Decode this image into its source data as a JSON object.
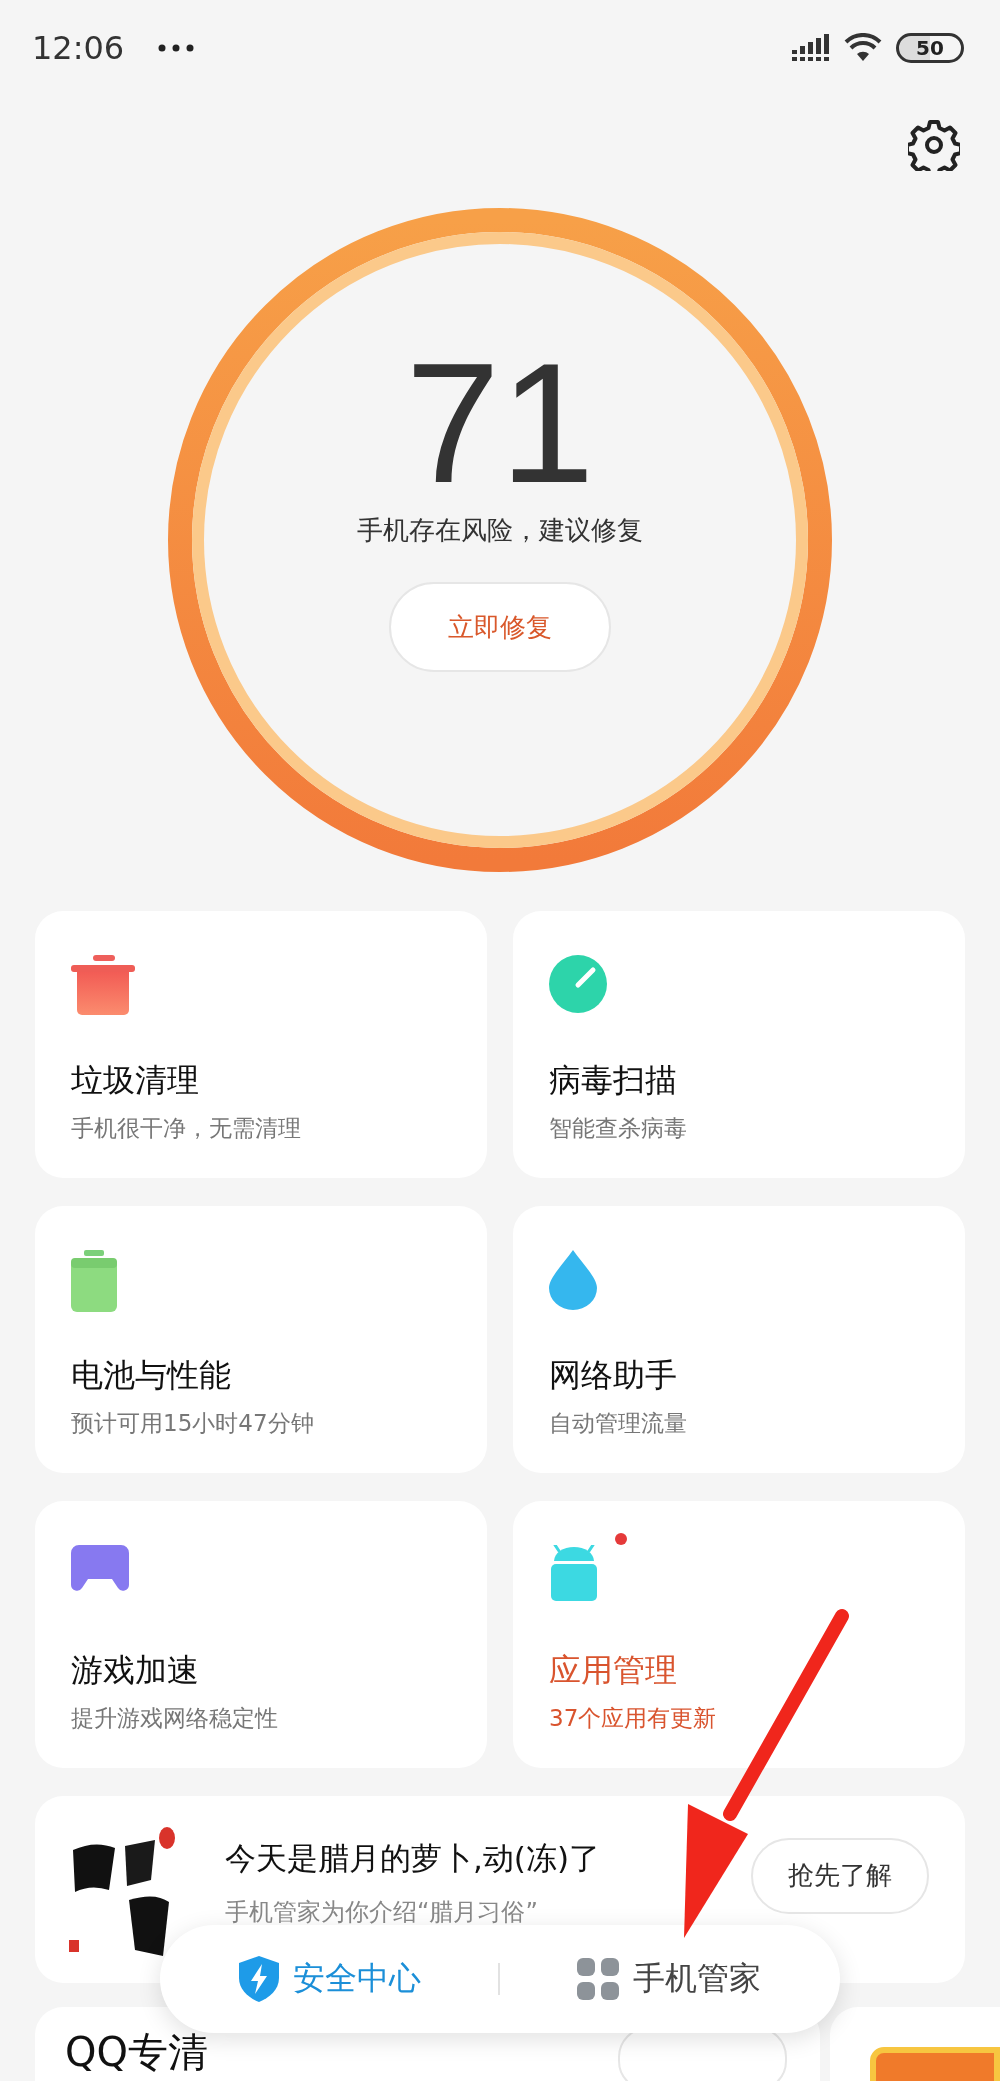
{
  "status_bar": {
    "time": "12:06",
    "battery": "50"
  },
  "score": {
    "value": "71",
    "message": "手机存在风险，建议修复",
    "action": "立即修复"
  },
  "tiles": [
    {
      "kind": "trash",
      "title": "垃圾清理",
      "subtitle": "手机很干净，无需清理",
      "highlight": false,
      "badge": false
    },
    {
      "kind": "gauge",
      "title": "病毒扫描",
      "subtitle": "智能查杀病毒",
      "highlight": false,
      "badge": false
    },
    {
      "kind": "battery",
      "title": "电池与性能",
      "subtitle": "预计可用15小时47分钟",
      "highlight": false,
      "badge": false
    },
    {
      "kind": "drop",
      "title": "网络助手",
      "subtitle": "自动管理流量",
      "highlight": false,
      "badge": false
    },
    {
      "kind": "gamepad",
      "title": "游戏加速",
      "subtitle": "提升游戏网络稳定性",
      "highlight": false,
      "badge": false
    },
    {
      "kind": "android",
      "title": "应用管理",
      "subtitle": "37个应用有更新",
      "highlight": true,
      "badge": true
    }
  ],
  "banner": {
    "title": "今天是腊月的萝卜,动(冻)了",
    "subtitle": "手机管家为你介绍“腊月习俗”",
    "action": "抢先了解"
  },
  "next_card": {
    "title": "QQ专清"
  },
  "bottom_nav": [
    {
      "kind": "shield",
      "label": "安全中心",
      "selected": true
    },
    {
      "kind": "grid",
      "label": "手机管家",
      "selected": false
    }
  ]
}
